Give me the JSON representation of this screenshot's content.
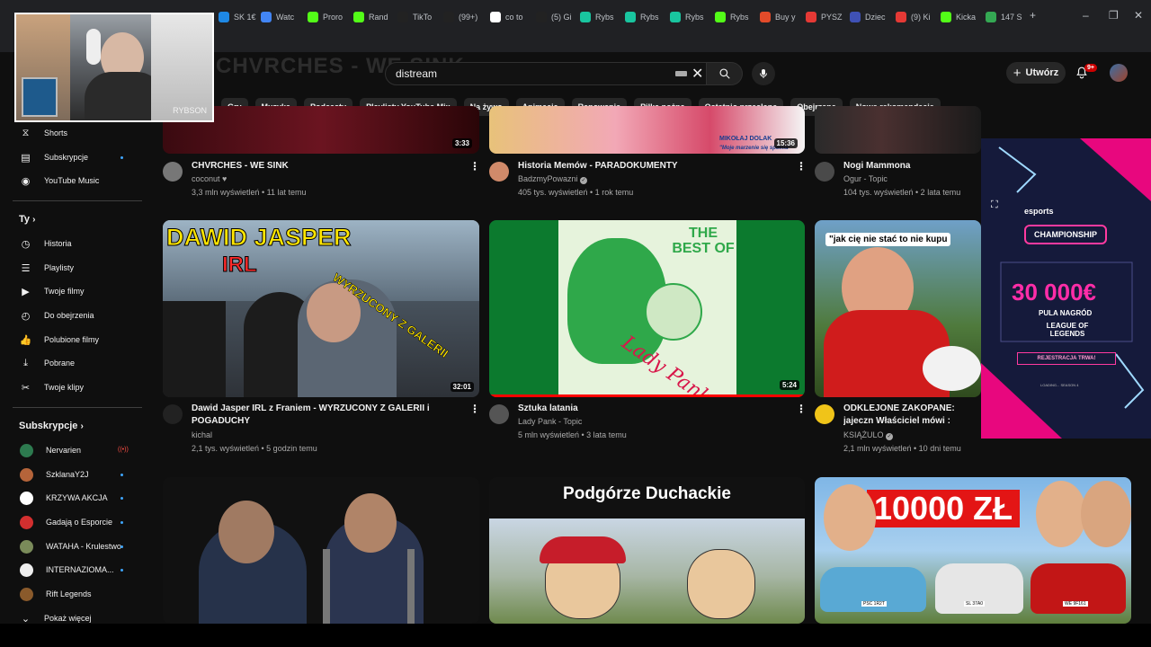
{
  "browser": {
    "tabs": [
      {
        "label": "SK 1€",
        "color": "#1e88e5"
      },
      {
        "label": "Watc",
        "color": "#4285f4"
      },
      {
        "label": "Proro",
        "color": "#53fc18"
      },
      {
        "label": "Rand",
        "color": "#53fc18"
      },
      {
        "label": "TikTo",
        "color": "#222"
      },
      {
        "label": "(99+)",
        "color": "#222"
      },
      {
        "label": "co to",
        "color": "#fff"
      },
      {
        "label": "(5) Gi",
        "color": "#222"
      },
      {
        "label": "Rybs",
        "color": "#19c59f"
      },
      {
        "label": "Rybs",
        "color": "#19c59f"
      },
      {
        "label": "Rybs",
        "color": "#19c59f"
      },
      {
        "label": "Rybs",
        "color": "#53fc18"
      },
      {
        "label": "Buy y",
        "color": "#e34b2a"
      },
      {
        "label": "PYSZ",
        "color": "#e53935"
      },
      {
        "label": "Dziec",
        "color": "#3f51b5"
      },
      {
        "label": "(9) Ki",
        "color": "#e53935"
      },
      {
        "label": "Kicka",
        "color": "#53fc18"
      },
      {
        "label": "147 S",
        "color": "#34a853"
      }
    ],
    "new_tab": "+"
  },
  "header": {
    "watermark": "CHVRCHES - WE SINK",
    "search_value": "distream",
    "create_label": "Utwórz",
    "notif_badge": "9+"
  },
  "chips": [
    "Gry",
    "Muzyka",
    "Podcasty",
    "Playlisty YouTube Mix",
    "Na żywo",
    "Animacja",
    "Rapowanie",
    "Piłka nożna",
    "Ostatnio przesłane",
    "Obejrzane",
    "Nowe rekomendacje"
  ],
  "sidebar": {
    "top": [
      "Shorts",
      "Subskrypcje",
      "YouTube Music"
    ],
    "you_heading": "Ty",
    "you": [
      "Historia",
      "Playlisty",
      "Twoje filmy",
      "Do obejrzenia",
      "Polubione filmy",
      "Pobrane",
      "Twoje klipy"
    ],
    "subs_heading": "Subskrypcje",
    "subs": [
      {
        "name": "Nervarien",
        "color": "#2d7a4f"
      },
      {
        "name": "SzklanaY2J",
        "color": "#b5643a"
      },
      {
        "name": "KRZYWA AKCJA",
        "color": "#ffffff"
      },
      {
        "name": "Gadają o Esporcie",
        "color": "#d32f2f"
      },
      {
        "name": "WATAHA - Krulestwo",
        "color": "#7a8b5a"
      },
      {
        "name": "INTERNAZIOMA...",
        "color": "#eeeeee"
      },
      {
        "name": "Rift Legends",
        "color": "#8a5a2b"
      }
    ],
    "more": "Pokaż więcej"
  },
  "videos": [
    {
      "title": "CHVRCHES - WE SINK",
      "channel": "coconut ♥",
      "meta": "3,3 mln wyświetleń • 11 lat temu",
      "duration": "3:33",
      "verified": false
    },
    {
      "title": "Historia Memów - PARADOKUMENTY",
      "channel": "BadzmyPowazni",
      "meta": "405 tys. wyświetleń • 1 rok temu",
      "duration": "15:36",
      "verified": true
    },
    {
      "title": "Nogi Mammona",
      "channel": "Ogur - Topic",
      "meta": "104 tys. wyświetleń • 2 lata temu",
      "duration": "",
      "verified": false
    },
    {
      "title": "Dawid Jasper IRL z Franiem - WYRZUCONY Z GALERII i POGADUCHY",
      "channel": "kichal",
      "meta": "2,1 tys. wyświetleń • 5 godzin temu",
      "duration": "32:01",
      "verified": false
    },
    {
      "title": "Sztuka latania",
      "channel": "Lady Pank - Topic",
      "meta": "5 mln wyświetleń • 3 lata temu",
      "duration": "5:24",
      "verified": false
    },
    {
      "title": "ODKLEJONE ZAKOPANE: jajeczn Właściciel mówi : \"POWINNO BY",
      "channel": "KSIĄŻULO",
      "meta": "2,1 mln wyświetleń • 10 dni temu",
      "duration": "",
      "verified": true
    }
  ],
  "thumb_text": {
    "t2_caption": "MIKOŁAJ DOLAK",
    "t2_quote": "\"Moje marzenie się spełnia\"",
    "t4_title": "DAWID JASPER",
    "t4_sub": "IRL",
    "t4_stamp": "WYRZUCONY Z GALERII",
    "t5_title": "THE BEST OF",
    "t5_script": "Lady Pank",
    "t6_quote": "\"jak cię nie stać to nie kupu",
    "t8_title": "Podgórze Duchackie",
    "t9_title": "10000 ZŁ",
    "t9_plate1": "PSC 1R2T",
    "t9_plate2": "SL 37A0",
    "t9_plate3": "WE 9F161"
  },
  "ad": {
    "brand": "esports",
    "champ": "CHAMPIONSHIP",
    "prize": "30 000€",
    "prize_sub": "PULA NAGRÓD",
    "lol": "LEAGUE OF LEGENDS",
    "register": "REJESTRACJA TRWA!",
    "fine": "LOADING... SEASON 4"
  },
  "cam": {
    "overlay_text": "RYBSON"
  }
}
